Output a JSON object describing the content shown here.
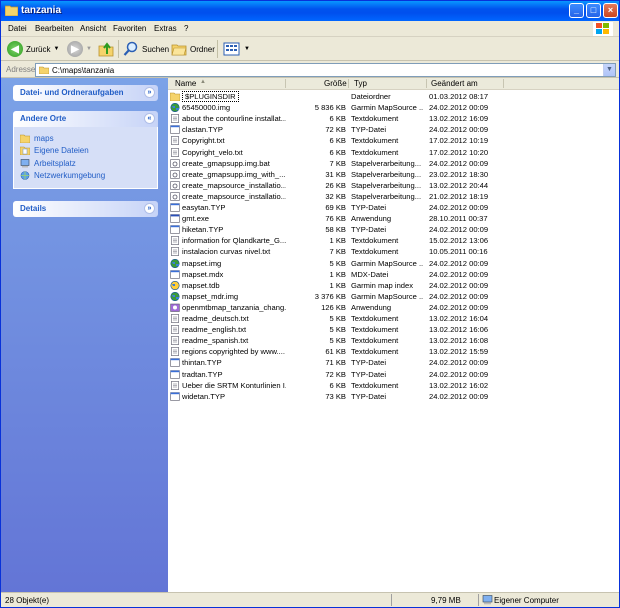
{
  "window": {
    "title": "tanzania"
  },
  "menu": [
    "Datei",
    "Bearbeiten",
    "Ansicht",
    "Favoriten",
    "Extras",
    "?"
  ],
  "toolbar": {
    "back": "Zurück",
    "search": "Suchen",
    "folders": "Ordner"
  },
  "address": {
    "label": "Adresse",
    "path": "C:\\maps\\tanzania"
  },
  "tasks": {
    "file_folder_tasks": "Datei- und Ordneraufgaben",
    "other_places": "Andere Orte",
    "places": [
      {
        "label": "maps",
        "icon": "folder-icon"
      },
      {
        "label": "Eigene Dateien",
        "icon": "documents-icon"
      },
      {
        "label": "Arbeitsplatz",
        "icon": "computer-icon"
      },
      {
        "label": "Netzwerkumgebung",
        "icon": "network-icon"
      }
    ],
    "details": "Details"
  },
  "columns": {
    "name": "Name",
    "size": "Größe",
    "type": "Typ",
    "date": "Geändert am"
  },
  "files": [
    {
      "name": "$PLUGINSDIR",
      "size": "",
      "type": "Dateiordner",
      "date": "01.03.2012 08:17",
      "icon": "folder"
    },
    {
      "name": "65450000.img",
      "size": "5 836 KB",
      "type": "Garmin MapSource ...",
      "date": "24.02.2012 00:09",
      "icon": "globe"
    },
    {
      "name": "about the contourline installat...",
      "size": "6 KB",
      "type": "Textdokument",
      "date": "13.02.2012 16:09",
      "icon": "text"
    },
    {
      "name": "clastan.TYP",
      "size": "72 KB",
      "type": "TYP-Datei",
      "date": "24.02.2012 00:09",
      "icon": "generic"
    },
    {
      "name": "Copyright.txt",
      "size": "6 KB",
      "type": "Textdokument",
      "date": "17.02.2012 10:19",
      "icon": "text"
    },
    {
      "name": "Copyright_velo.txt",
      "size": "6 KB",
      "type": "Textdokument",
      "date": "17.02.2012 10:20",
      "icon": "text"
    },
    {
      "name": "create_gmapsupp.img.bat",
      "size": "7 KB",
      "type": "Stapelverarbeitung...",
      "date": "24.02.2012 00:09",
      "icon": "batch"
    },
    {
      "name": "create_gmapsupp.img_with_...",
      "size": "31 KB",
      "type": "Stapelverarbeitung...",
      "date": "23.02.2012 18:30",
      "icon": "batch"
    },
    {
      "name": "create_mapsource_installatio...",
      "size": "26 KB",
      "type": "Stapelverarbeitung...",
      "date": "13.02.2012 20:44",
      "icon": "batch"
    },
    {
      "name": "create_mapsource_installatio...",
      "size": "32 KB",
      "type": "Stapelverarbeitung...",
      "date": "21.02.2012 18:19",
      "icon": "batch"
    },
    {
      "name": "easytan.TYP",
      "size": "69 KB",
      "type": "TYP-Datei",
      "date": "24.02.2012 00:09",
      "icon": "generic"
    },
    {
      "name": "gmt.exe",
      "size": "76 KB",
      "type": "Anwendung",
      "date": "28.10.2011 00:37",
      "icon": "exe"
    },
    {
      "name": "hiketan.TYP",
      "size": "58 KB",
      "type": "TYP-Datei",
      "date": "24.02.2012 00:09",
      "icon": "generic"
    },
    {
      "name": "information for Qlandkarte_G...",
      "size": "1 KB",
      "type": "Textdokument",
      "date": "15.02.2012 13:06",
      "icon": "text"
    },
    {
      "name": "instalacion curvas nivel.txt",
      "size": "7 KB",
      "type": "Textdokument",
      "date": "10.05.2011 00:16",
      "icon": "text"
    },
    {
      "name": "mapset.img",
      "size": "5 KB",
      "type": "Garmin MapSource ...",
      "date": "24.02.2012 00:09",
      "icon": "globe"
    },
    {
      "name": "mapset.mdx",
      "size": "1 KB",
      "type": "MDX-Datei",
      "date": "24.02.2012 00:09",
      "icon": "generic"
    },
    {
      "name": "mapset.tdb",
      "size": "1 KB",
      "type": "Garmin map index",
      "date": "24.02.2012 00:09",
      "icon": "globe2"
    },
    {
      "name": "mapset_mdr.img",
      "size": "3 376 KB",
      "type": "Garmin MapSource ...",
      "date": "24.02.2012 00:09",
      "icon": "globe"
    },
    {
      "name": "openmtbmap_tanzania_chang...",
      "size": "126 KB",
      "type": "Anwendung",
      "date": "24.02.2012 00:09",
      "icon": "installer"
    },
    {
      "name": "readme_deutsch.txt",
      "size": "5 KB",
      "type": "Textdokument",
      "date": "13.02.2012 16:04",
      "icon": "text"
    },
    {
      "name": "readme_english.txt",
      "size": "5 KB",
      "type": "Textdokument",
      "date": "13.02.2012 16:06",
      "icon": "text"
    },
    {
      "name": "readme_spanish.txt",
      "size": "5 KB",
      "type": "Textdokument",
      "date": "13.02.2012 16:08",
      "icon": "text"
    },
    {
      "name": "regions copyrighted by www....",
      "size": "61 KB",
      "type": "Textdokument",
      "date": "13.02.2012 15:59",
      "icon": "text"
    },
    {
      "name": "thintan.TYP",
      "size": "71 KB",
      "type": "TYP-Datei",
      "date": "24.02.2012 00:09",
      "icon": "generic"
    },
    {
      "name": "tradtan.TYP",
      "size": "72 KB",
      "type": "TYP-Datei",
      "date": "24.02.2012 00:09",
      "icon": "generic"
    },
    {
      "name": "Ueber die SRTM Konturlinien I...",
      "size": "6 KB",
      "type": "Textdokument",
      "date": "13.02.2012 16:02",
      "icon": "text"
    },
    {
      "name": "widetan.TYP",
      "size": "73 KB",
      "type": "TYP-Datei",
      "date": "24.02.2012 00:09",
      "icon": "generic"
    }
  ],
  "status": {
    "objects": "28 Objekt(e)",
    "total_size": "9,79 MB",
    "location": "Eigener Computer"
  }
}
